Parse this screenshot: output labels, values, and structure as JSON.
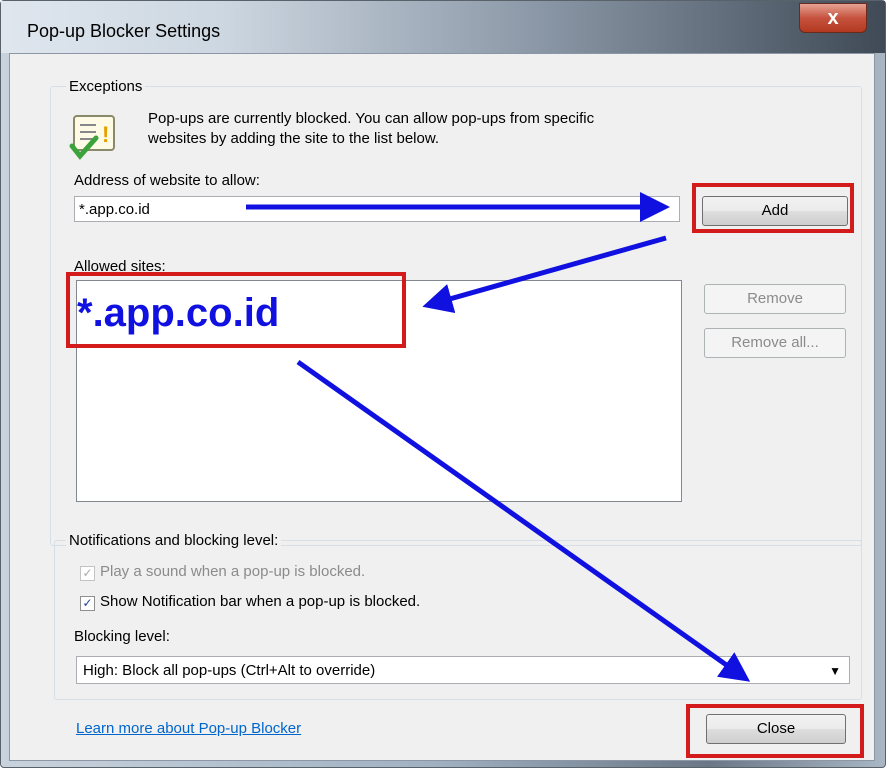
{
  "window": {
    "title": "Pop-up Blocker Settings",
    "close_glyph": "x"
  },
  "exceptions": {
    "group_label": "Exceptions",
    "info_line1": "Pop-ups are currently blocked.  You can allow pop-ups from specific",
    "info_line2": "websites by adding the site to the list below.",
    "address_label": "Address of website to allow:",
    "address_value": "*.app.co.id",
    "add_label": "Add",
    "allowed_label": "Allowed sites:",
    "allowed_sites": [
      "*.app.co.id"
    ],
    "remove_label": "Remove",
    "remove_all_label": "Remove all..."
  },
  "notifications": {
    "group_label": "Notifications and blocking level:",
    "play_sound_label": "Play a sound when a pop-up is blocked.",
    "play_sound_checked": true,
    "show_bar_label": "Show Notification bar when a pop-up is blocked.",
    "show_bar_checked": true,
    "blocking_label": "Blocking level:",
    "blocking_value": "High: Block all pop-ups (Ctrl+Alt to override)"
  },
  "footer": {
    "learn_more_label": "Learn more about Pop-up Blocker",
    "close_label": "Close"
  },
  "colors": {
    "annotation_red": "#d41b1b",
    "annotation_blue": "#1010e0"
  }
}
